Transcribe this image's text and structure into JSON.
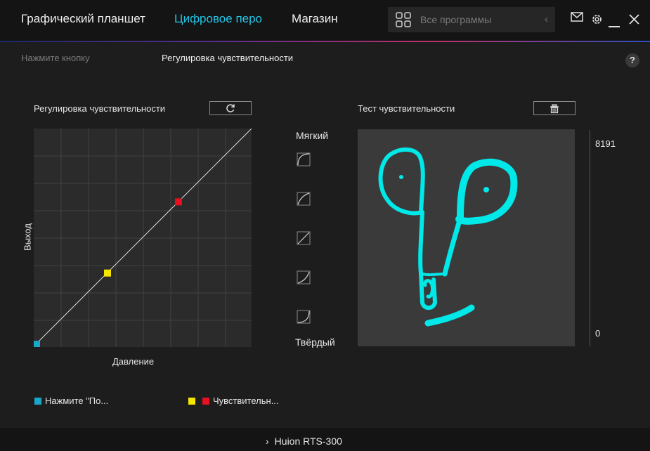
{
  "header": {
    "tabs": [
      {
        "label": "Графический планшет"
      },
      {
        "label": "Цифровое перо",
        "active": true
      },
      {
        "label": "Магазин"
      }
    ],
    "search": {
      "placeholder": "Все программы"
    },
    "icons": [
      "apps-grid-icon",
      "chevron-left-icon",
      "mail-icon",
      "gear-icon",
      "minimize-icon",
      "close-icon"
    ]
  },
  "subnav": {
    "left": "Нажмите кнопку",
    "right": "Регулировка чувствительности",
    "help": "?"
  },
  "sensitivity": {
    "title": "Регулировка чувствительности",
    "x_label": "Давление",
    "y_label": "Выход",
    "points": [
      {
        "pressure": 0.0,
        "output": 0.0,
        "color": "#1aa6c9"
      },
      {
        "pressure": 0.33,
        "output": 0.33,
        "color": "#f5e600"
      },
      {
        "pressure": 0.66,
        "output": 0.66,
        "color": "#e8101e"
      }
    ]
  },
  "presets": {
    "soft": "Мягкий",
    "hard": "Твёрдый",
    "items": [
      "preset-soft-1",
      "preset-soft-2",
      "preset-linear",
      "preset-hard-1",
      "preset-hard-2"
    ]
  },
  "test": {
    "title": "Тест чувствительности",
    "max": "8191",
    "min": "0",
    "stroke_color": "#00e8e8"
  },
  "legend": {
    "item1": "Нажмите \"По...",
    "item2": "Чувствительн..."
  },
  "footer": {
    "device": "Huion RTS-300"
  }
}
